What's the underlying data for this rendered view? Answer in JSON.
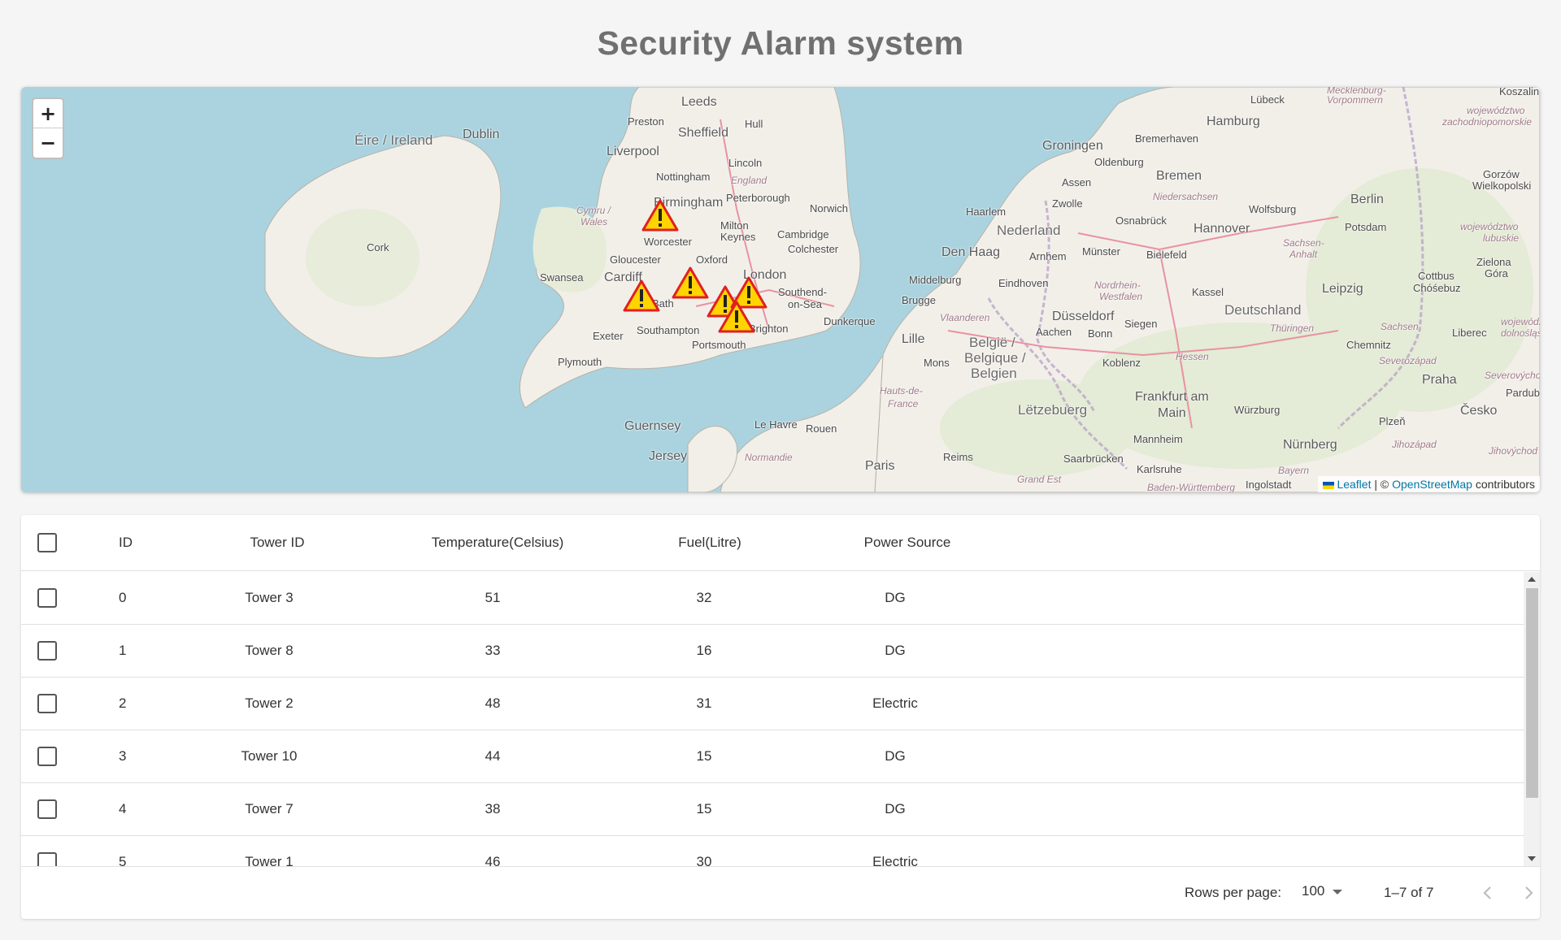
{
  "page": {
    "title": "Security Alarm system"
  },
  "map": {
    "zoom_in_label": "+",
    "zoom_out_label": "−",
    "marker_icon": "warning-triangle-icon",
    "marker_colors": {
      "fill": "#ffd400",
      "stroke": "#e02020"
    },
    "labels": {
      "leeds": "Leeds",
      "dublin": "Dublin",
      "eire": "Éire / Ireland",
      "preston": "Preston",
      "sheffield": "Sheffield",
      "hull": "Hull",
      "liverpool": "Liverpool",
      "lincoln": "Lincoln",
      "nottingham": "Nottingham",
      "england": "England",
      "cymru": "Cymru /",
      "wales": "Wales",
      "birmingham": "Birmingham",
      "peterborough": "Peterborough",
      "norwich": "Norwich",
      "cork": "Cork",
      "worcester": "Worcester",
      "milton": "Milton",
      "keynes": "Keynes",
      "cambridge": "Cambridge",
      "colchester": "Colchester",
      "gloucester": "Gloucester",
      "oxford": "Oxford",
      "swansea": "Swansea",
      "cardiff": "Cardiff",
      "london": "London",
      "bath": "Bath",
      "southend": "Southend-",
      "onsea": "on-Sea",
      "exeter": "Exeter",
      "southampton": "Southampton",
      "brighton": "Brighton",
      "portsmouth": "Portsmouth",
      "plymouth": "Plymouth",
      "guernsey": "Guernsey",
      "jersey": "Jersey",
      "lehavre": "Le Havre",
      "rouen": "Rouen",
      "normandie": "Normandie",
      "paris": "Paris",
      "reims": "Reims",
      "dunkerque": "Dunkerque",
      "lille": "Lille",
      "mons": "Mons",
      "hautsdefrance": "Hauts-de-",
      "france": "France",
      "grandest": "Grand Est",
      "brugge": "Brugge",
      "middelburg": "Middelburg",
      "vlaanderen": "Vlaanderen",
      "belgie": "België /",
      "belgique": "Belgique /",
      "belgien": "Belgien",
      "letzebuerg": "Lëtzebuerg",
      "denhaag": "Den Haag",
      "haarlem": "Haarlem",
      "nederland": "Nederland",
      "eindhoven": "Eindhoven",
      "arnhem": "Arnhem",
      "zwolle": "Zwolle",
      "assen": "Assen",
      "groningen": "Groningen",
      "oldenburg": "Oldenburg",
      "bremerhaven": "Bremerhaven",
      "bremen": "Bremen",
      "hamburg": "Hamburg",
      "lubeck": "Lübeck",
      "niedersachsen": "Niedersachsen",
      "osnabruck": "Osnabrück",
      "munster": "Münster",
      "bielefeld": "Bielefeld",
      "hannover": "Hannover",
      "wolfsburg": "Wolfsburg",
      "berlin": "Berlin",
      "potsdam": "Potsdam",
      "nordrhein": "Nordrhein-",
      "westfalen": "Westfalen",
      "dusseldorf": "Düsseldorf",
      "aachen": "Aachen",
      "bonn": "Bonn",
      "siegen": "Siegen",
      "kassel": "Kassel",
      "deutschland": "Deutschland",
      "leipzig": "Leipzig",
      "koblenz": "Koblenz",
      "hessen": "Hessen",
      "frankfurt": "Frankfurt am",
      "main": "Main",
      "thuringen": "Thüringen",
      "sachsen": "Sachsen",
      "chemnitz": "Chemnitz",
      "wurzburg": "Würzburg",
      "mannheim": "Mannheim",
      "saarbrucken": "Saarbrücken",
      "karlsruhe": "Karlsruhe",
      "nurnberg": "Nürnberg",
      "bayern": "Bayern",
      "ingolstadt": "Ingolstadt",
      "badenw": "Baden-Württemberg",
      "praha": "Praha",
      "cesko": "Česko",
      "plzen": "Plzeň",
      "liberec": "Liberec",
      "cottbus": "Cottbus",
      "chosebuz": "Chóśebuz",
      "zielona": "Zielona",
      "gora": "Góra",
      "gorzow": "Gorzów",
      "wielkopolski": "Wielkopolski",
      "koszalin": "Koszalin",
      "sachsenanhalt": "Sachsen-",
      "anhalt": "Anhalt",
      "mecklenburg": "Mecklenburg-",
      "vorpommern": "Vorpommern",
      "wojzachod": "województwo",
      "zachodniopomorskie": "zachodniopomorskie",
      "wojlubuskie": "województwo",
      "lubuskie": "lubuskie",
      "wojdolno": "województwo",
      "dolnoslaskie": "dolnośląskie",
      "severozapad": "Severozápad",
      "severovychod": "Severovýchod",
      "jihozapad": "Jihozápad",
      "jihovychod": "Jihovýchod",
      "pardubice": "Pardubi"
    },
    "attribution": {
      "leaflet": "Leaflet",
      "sep": " | © ",
      "osm": "OpenStreetMap",
      "rest": " contributors"
    }
  },
  "table": {
    "headers": {
      "id": "ID",
      "tower_id": "Tower ID",
      "temperature": "Temperature(Celsius)",
      "fuel": "Fuel(Litre)",
      "power_source": "Power Source"
    },
    "rows": [
      {
        "id": "0",
        "tower": "Tower 3",
        "temp": "51",
        "fuel": "32",
        "power": "DG"
      },
      {
        "id": "1",
        "tower": "Tower 8",
        "temp": "33",
        "fuel": "16",
        "power": "DG"
      },
      {
        "id": "2",
        "tower": "Tower 2",
        "temp": "48",
        "fuel": "31",
        "power": "Electric"
      },
      {
        "id": "3",
        "tower": "Tower 10",
        "temp": "44",
        "fuel": "15",
        "power": "DG"
      },
      {
        "id": "4",
        "tower": "Tower 7",
        "temp": "38",
        "fuel": "15",
        "power": "DG"
      },
      {
        "id": "5",
        "tower": "Tower 1",
        "temp": "46",
        "fuel": "30",
        "power": "Electric"
      }
    ],
    "footer": {
      "rows_per_page_label": "Rows per page:",
      "rows_per_page_value": "100",
      "page_info": "1–7 of 7"
    }
  }
}
